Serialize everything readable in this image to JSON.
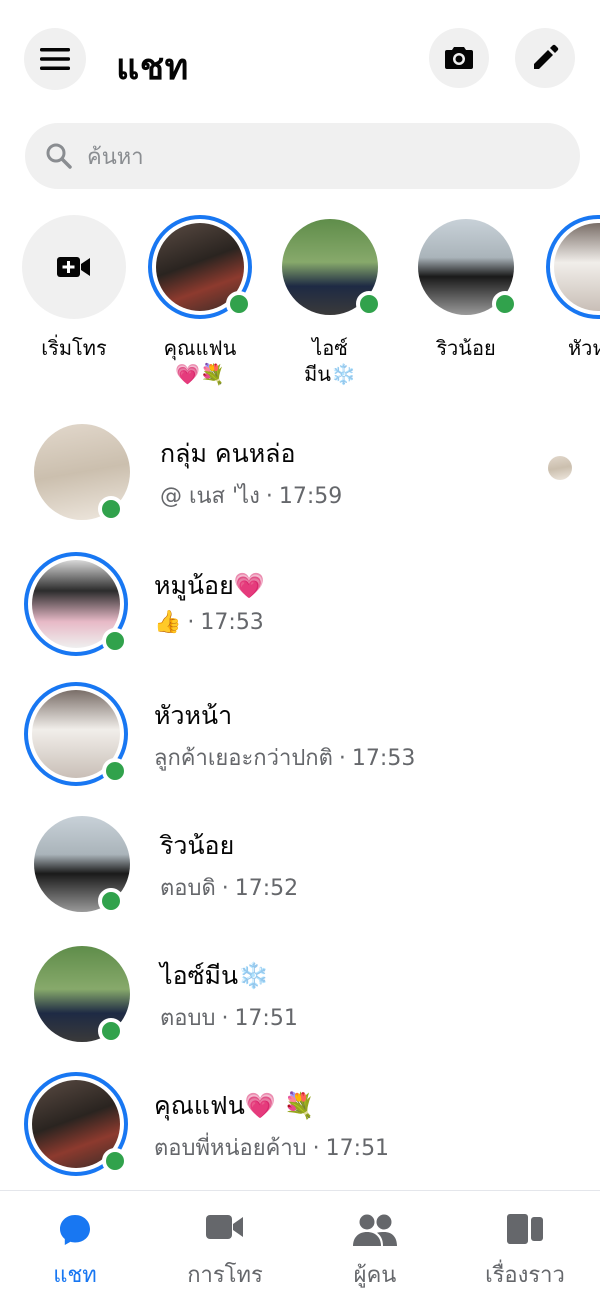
{
  "header": {
    "title": "แชท"
  },
  "search": {
    "placeholder": "ค้นหา"
  },
  "stories": [
    {
      "label": "เริ่มโทร"
    },
    {
      "label": "คุณแฟน",
      "label2": "💗💐"
    },
    {
      "label": "ไอซ์",
      "label2": "มีน❄️"
    },
    {
      "label": "ริวน้อย"
    },
    {
      "label": "หัวห"
    }
  ],
  "chats": [
    {
      "name": "กลุ่ม คนหล่อ",
      "preview": "@ เนส 'ไง",
      "time": "17:59"
    },
    {
      "name": "หมูน้อย💗",
      "preview": "👍",
      "time": "17:53"
    },
    {
      "name": "หัวหน้า",
      "preview": "ลูกค้าเยอะกว่าปกติ",
      "time": "17:53"
    },
    {
      "name": "ริวน้อย",
      "preview": "ตอบดิ",
      "time": "17:52"
    },
    {
      "name": "ไอซ์มีน❄️",
      "preview": "ตอบบ",
      "time": "17:51"
    },
    {
      "name": "คุณแฟน💗 💐",
      "preview": "ตอบพี่หน่อยค้าบ",
      "time": "17:51"
    }
  ],
  "nav": [
    {
      "label": "แชท",
      "icon": "chat-bubble-icon",
      "active": true
    },
    {
      "label": "การโทร",
      "icon": "video-camera-icon",
      "active": false
    },
    {
      "label": "ผู้คน",
      "icon": "people-icon",
      "active": false
    },
    {
      "label": "เรื่องราว",
      "icon": "stories-icon",
      "active": false
    }
  ],
  "colors": {
    "accent": "#1877f2",
    "online": "#31a24c",
    "muted": "#65676b",
    "surface": "#f0f0f0"
  }
}
